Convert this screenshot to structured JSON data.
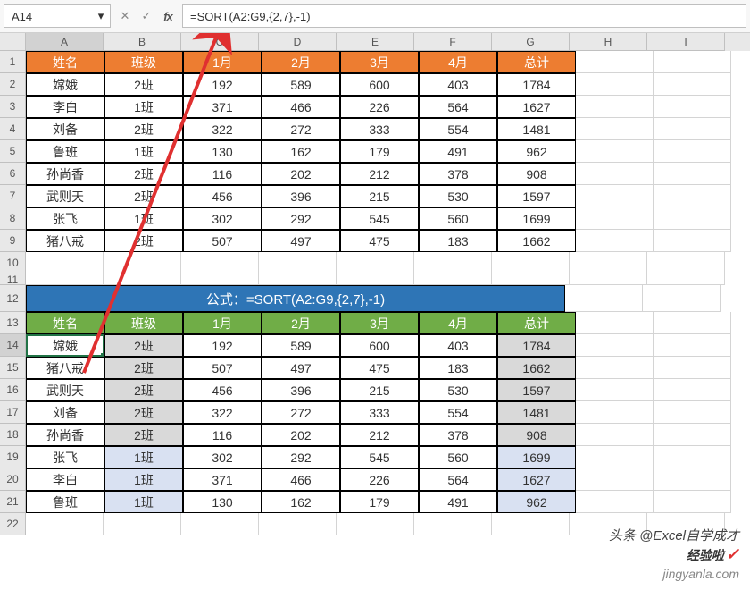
{
  "active_cell": "A14",
  "formula": "=SORT(A2:G9,{2,7},-1)",
  "col_letters": [
    "A",
    "B",
    "C",
    "D",
    "E",
    "F",
    "G",
    "H",
    "I"
  ],
  "top": {
    "headers": [
      "姓名",
      "班级",
      "1月",
      "2月",
      "3月",
      "4月",
      "总计"
    ],
    "rows": [
      [
        "嫦娥",
        "2班",
        "192",
        "589",
        "600",
        "403",
        "1784"
      ],
      [
        "李白",
        "1班",
        "371",
        "466",
        "226",
        "564",
        "1627"
      ],
      [
        "刘备",
        "2班",
        "322",
        "272",
        "333",
        "554",
        "1481"
      ],
      [
        "鲁班",
        "1班",
        "130",
        "162",
        "179",
        "491",
        "962"
      ],
      [
        "孙尚香",
        "2班",
        "116",
        "202",
        "212",
        "378",
        "908"
      ],
      [
        "武则天",
        "2班",
        "456",
        "396",
        "215",
        "530",
        "1597"
      ],
      [
        "张飞",
        "1班",
        "302",
        "292",
        "545",
        "560",
        "1699"
      ],
      [
        "猪八戒",
        "2班",
        "507",
        "497",
        "475",
        "183",
        "1662"
      ]
    ]
  },
  "banner": "公式：=SORT(A2:G9,{2,7},-1)",
  "bottom": {
    "headers": [
      "姓名",
      "班级",
      "1月",
      "2月",
      "3月",
      "4月",
      "总计"
    ],
    "rows": [
      {
        "cells": [
          "嫦娥",
          "2班",
          "192",
          "589",
          "600",
          "403",
          "1784"
        ],
        "hl": "gray"
      },
      {
        "cells": [
          "猪八戒",
          "2班",
          "507",
          "497",
          "475",
          "183",
          "1662"
        ],
        "hl": "gray"
      },
      {
        "cells": [
          "武则天",
          "2班",
          "456",
          "396",
          "215",
          "530",
          "1597"
        ],
        "hl": "gray"
      },
      {
        "cells": [
          "刘备",
          "2班",
          "322",
          "272",
          "333",
          "554",
          "1481"
        ],
        "hl": "gray"
      },
      {
        "cells": [
          "孙尚香",
          "2班",
          "116",
          "202",
          "212",
          "378",
          "908"
        ],
        "hl": "gray"
      },
      {
        "cells": [
          "张飞",
          "1班",
          "302",
          "292",
          "545",
          "560",
          "1699"
        ],
        "hl": "blue"
      },
      {
        "cells": [
          "李白",
          "1班",
          "371",
          "466",
          "226",
          "564",
          "1627"
        ],
        "hl": "blue"
      },
      {
        "cells": [
          "鲁班",
          "1班",
          "130",
          "162",
          "179",
          "491",
          "962"
        ],
        "hl": "blue"
      }
    ]
  },
  "watermark": {
    "line1": "头条 @Excel自学成才",
    "line2_brand": "经验啦",
    "line2_url": "jingyanla.com"
  },
  "icons": {
    "chev": "▾",
    "cancel": "✕",
    "confirm": "✓",
    "fx": "fx"
  }
}
